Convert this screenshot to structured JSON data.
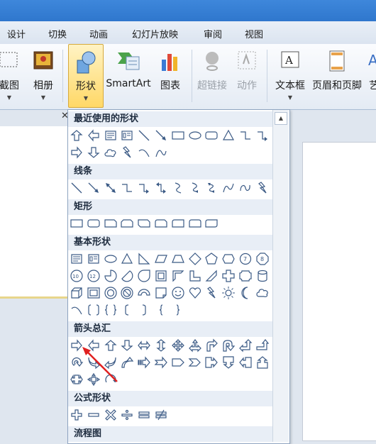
{
  "tabs": [
    "设计",
    "切换",
    "动画",
    "幻灯片放映",
    "审阅",
    "视图"
  ],
  "ribbon": {
    "screenshot": "截图",
    "album": "相册",
    "shapes": "形状",
    "smartart": "SmartArt",
    "chart": "图表",
    "hyperlink": "超链接",
    "action": "动作",
    "textbox": "文本框",
    "header_footer": "页眉和页脚",
    "wordart": "艺"
  },
  "gallery": {
    "sections": [
      {
        "title": "最近使用的形状",
        "rows": [
          [
            "arrow-up",
            "arrow-left",
            "rect-text",
            "rect-text2",
            "line",
            "line-arrow",
            "rect",
            "oval",
            "rounded-rect",
            "triangle",
            "elbow",
            "elbow-arrow"
          ],
          [
            "arrow-right",
            "arrow-down",
            "cloud-small",
            "lightning",
            "arc",
            "curve"
          ]
        ]
      },
      {
        "title": "线条",
        "rows": [
          [
            "line",
            "line-arrow",
            "line-double-arrow",
            "elbow",
            "elbow-arrow",
            "elbow-double-arrow",
            "curve-s",
            "curve-s-arrow",
            "curve-s-double",
            "freeform",
            "scribble",
            "lightning"
          ]
        ]
      },
      {
        "title": "矩形",
        "rows": [
          [
            "rect",
            "rounded-rect",
            "snip-rect",
            "snip-rect2",
            "snip-diag",
            "round-snip",
            "round-rect2",
            "round-rect3",
            "round-diag"
          ]
        ]
      },
      {
        "title": "基本形状",
        "rows": [
          [
            "rect-text",
            "rect-text2",
            "oval",
            "triangle",
            "right-triangle",
            "parallelogram",
            "trapezoid",
            "diamond",
            "pentagon",
            "hexagon",
            "heptagon",
            "octagon"
          ],
          [
            "decagon",
            "dodecagon",
            "pie",
            "chord",
            "teardrop",
            "frame",
            "half-frame",
            "l-shape",
            "diagonal-stripe",
            "cross",
            "plaque",
            "can"
          ],
          [
            "cube",
            "bevel",
            "donut",
            "no-symbol",
            "block-arc",
            "folded-corner",
            "smiley",
            "heart",
            "lightning",
            "sun",
            "moon",
            "cloud"
          ],
          [
            "arc",
            "bracket-pair",
            "brace-pair",
            "left-bracket",
            "right-bracket",
            "left-brace",
            "right-brace"
          ]
        ]
      },
      {
        "title": "箭头总汇",
        "rows": [
          [
            "arrow-right",
            "arrow-left",
            "arrow-up",
            "arrow-down",
            "left-right-arrow",
            "up-down-arrow",
            "quad-arrow",
            "left-right-up",
            "bent-arrow",
            "u-turn",
            "left-up-arrow",
            "bent-up-arrow"
          ],
          [
            "circular-arrow",
            "curved-right",
            "curved-left",
            "curved-up",
            "striped-right",
            "notched-right",
            "pentagon-arrow",
            "chevron",
            "right-callout",
            "down-callout",
            "left-callout",
            "up-callout"
          ],
          [
            "left-right-callout",
            "quad-callout",
            "circular-arrow2"
          ]
        ]
      },
      {
        "title": "公式形状",
        "rows": [
          [
            "plus",
            "minus",
            "multiply",
            "divide",
            "equal",
            "not-equal"
          ]
        ]
      },
      {
        "title": "流程图",
        "rows": []
      }
    ]
  },
  "colors": {
    "accent": "#2f77cd",
    "shape_stroke": "#3b5a85",
    "section_bg": "#e8eef6",
    "active_button": "#ffd867",
    "pointer_arrow": "#e02020"
  }
}
